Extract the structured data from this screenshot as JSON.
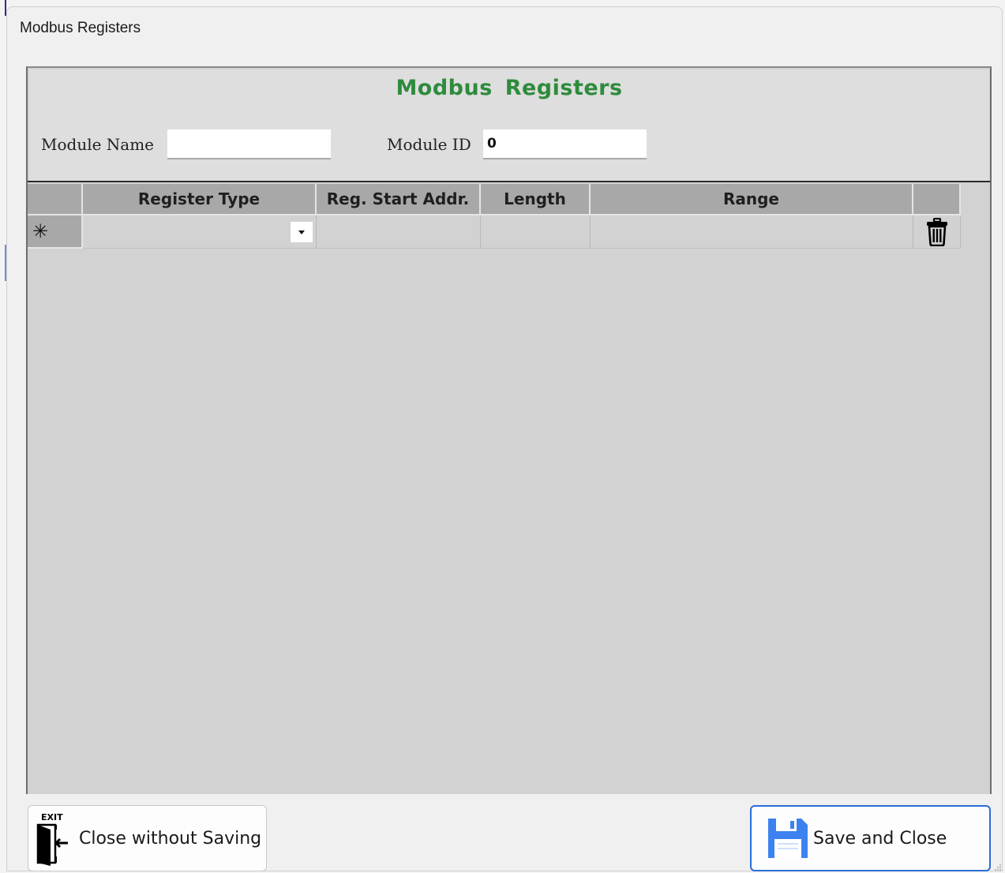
{
  "window": {
    "title": "Modbus Registers"
  },
  "form": {
    "title": "Modbus  Registers",
    "module_name_label": "Module Name",
    "module_name_value": "",
    "module_id_label": "Module ID",
    "module_id_value": "0"
  },
  "grid": {
    "columns": [
      "",
      "Register Type",
      "Reg. Start Addr.",
      "Length",
      "Range",
      ""
    ],
    "new_row": {
      "selector_glyph": "✳",
      "register_type": "",
      "start_addr": "",
      "length": "",
      "range": "",
      "delete_icon": "trash-icon"
    }
  },
  "buttons": {
    "close_without_saving": {
      "label": "Close without Saving",
      "icon": "exit-door-icon",
      "icon_text": "EXIT"
    },
    "save_and_close": {
      "label": "Save and Close",
      "icon": "floppy-disk-icon"
    }
  },
  "colors": {
    "title_green": "#2e8b3c",
    "save_border_blue": "#2a6ed6",
    "floppy_blue": "#3b82f0"
  }
}
